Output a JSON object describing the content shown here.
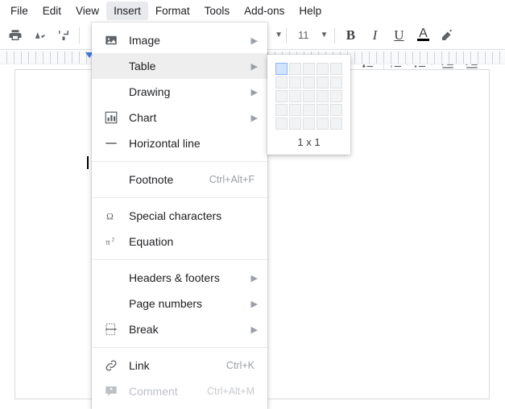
{
  "menubar": {
    "items": [
      {
        "label": "File"
      },
      {
        "label": "Edit"
      },
      {
        "label": "View"
      },
      {
        "label": "Insert"
      },
      {
        "label": "Format"
      },
      {
        "label": "Tools"
      },
      {
        "label": "Add-ons"
      },
      {
        "label": "Help"
      }
    ],
    "activeIndex": 3
  },
  "toolbar": {
    "fontsize": "11"
  },
  "insertMenu": {
    "items": [
      {
        "icon": "image-icon",
        "label": "Image",
        "submenu": true
      },
      {
        "icon": "table-icon",
        "label": "Table",
        "submenu": true,
        "hover": true
      },
      {
        "icon": "drawing-icon",
        "label": "Drawing",
        "submenu": true
      },
      {
        "icon": "chart-icon",
        "label": "Chart",
        "submenu": true
      },
      {
        "icon": "hr-icon",
        "label": "Horizontal line"
      },
      {
        "sep": true
      },
      {
        "icon": "",
        "label": "Footnote",
        "accel": "Ctrl+Alt+F"
      },
      {
        "sep": true
      },
      {
        "icon": "omega-icon",
        "label": "Special characters"
      },
      {
        "icon": "pi-icon",
        "label": "Equation"
      },
      {
        "sep": true
      },
      {
        "icon": "",
        "label": "Headers & footers",
        "submenu": true
      },
      {
        "icon": "",
        "label": "Page numbers",
        "submenu": true
      },
      {
        "icon": "break-icon",
        "label": "Break",
        "submenu": true
      },
      {
        "sep": true
      },
      {
        "icon": "link-icon",
        "label": "Link",
        "accel": "Ctrl+K"
      },
      {
        "icon": "comment-icon",
        "label": "Comment",
        "accel": "Ctrl+Alt+M",
        "disabled": true
      }
    ]
  },
  "tableFlyout": {
    "cols": 5,
    "rows": 5,
    "selCols": 1,
    "selRows": 1,
    "label": "1 x 1"
  }
}
